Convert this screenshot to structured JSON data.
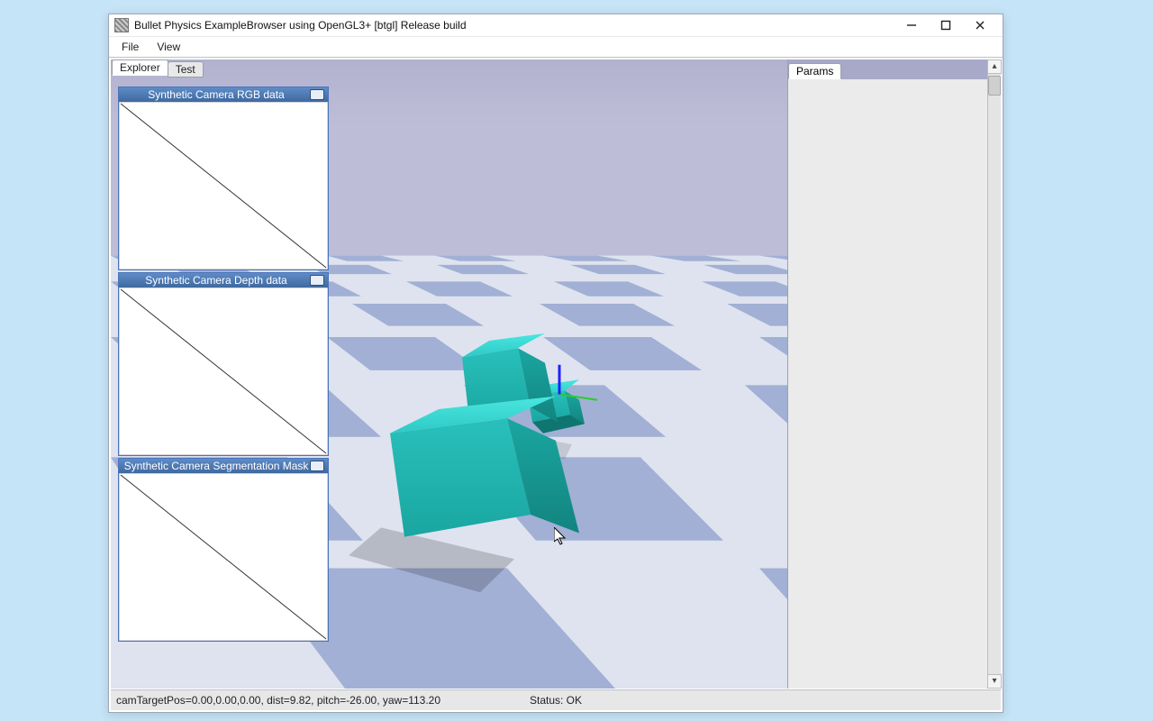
{
  "window": {
    "title": "Bullet Physics ExampleBrowser using OpenGL3+ [btgl] Release build"
  },
  "menu": {
    "file": "File",
    "view": "View"
  },
  "left_tabs": {
    "explorer": "Explorer",
    "test": "Test",
    "active": "explorer"
  },
  "params_tab": {
    "label": "Params"
  },
  "camera_windows": [
    {
      "title": "Synthetic Camera RGB data"
    },
    {
      "title": "Synthetic Camera Depth data"
    },
    {
      "title": "Synthetic Camera Segmentation Mask"
    }
  ],
  "status": {
    "left": "camTargetPos=0.00,0.00,0.00, dist=9.82, pitch=-26.00, yaw=113.20",
    "mid": "Status: OK",
    "camTargetPos": [
      0.0,
      0.0,
      0.0
    ],
    "dist": 9.82,
    "pitch": -26.0,
    "yaw": 113.2
  },
  "colors": {
    "accent_blue": "#40699f",
    "cube": "#2dc9c4"
  }
}
